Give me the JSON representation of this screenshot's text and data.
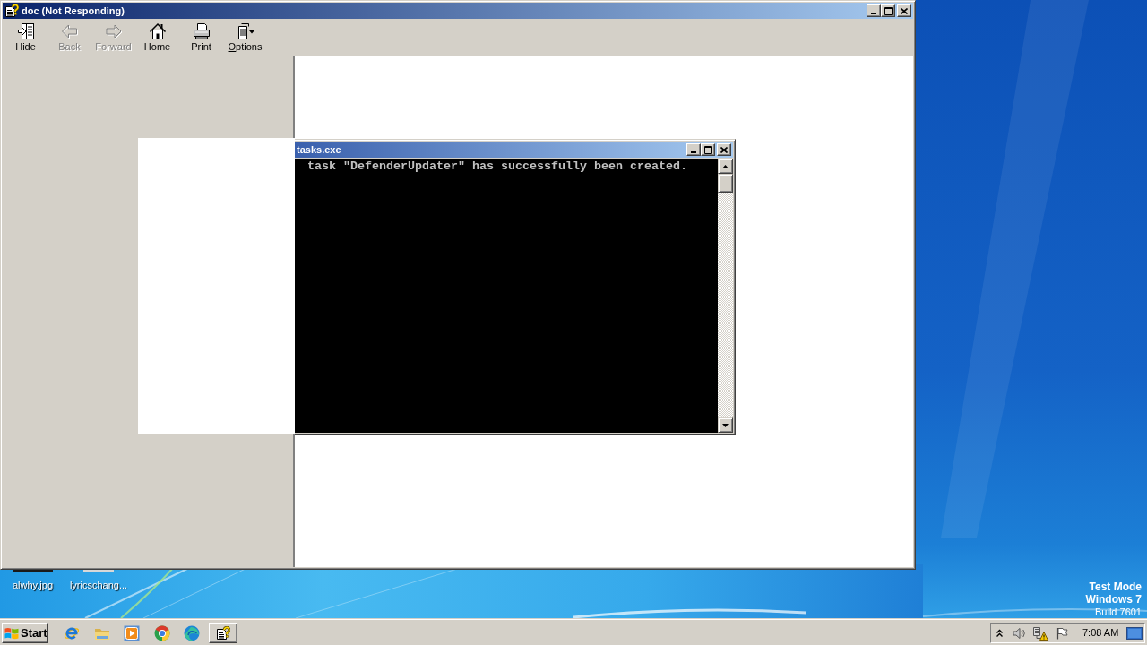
{
  "help_window": {
    "title": "doc (Not Responding)",
    "toolbar": [
      {
        "label": "Hide",
        "disabled": false,
        "underline_first": false
      },
      {
        "label": "Back",
        "disabled": true,
        "underline_first": false
      },
      {
        "label": "Forward",
        "disabled": true,
        "underline_first": false
      },
      {
        "label": "Home",
        "disabled": false,
        "underline_first": false
      },
      {
        "label": "Print",
        "disabled": false,
        "underline_first": false
      },
      {
        "label": "Options",
        "disabled": false,
        "underline_first": true
      }
    ]
  },
  "console_window": {
    "title": "tasks.exe",
    "lines": [
      "task \"DefenderUpdater\" has successfully been created."
    ]
  },
  "desktop": {
    "icons": [
      {
        "label": "alwhy.jpg"
      },
      {
        "label": "lyricschang..."
      }
    ],
    "system_text": [
      {
        "text": "Test Mode",
        "bold": true
      },
      {
        "text": "Windows 7",
        "bold": true
      },
      {
        "text": "Build 7601",
        "bold": false
      }
    ]
  },
  "taskbar": {
    "start_label": "Start",
    "clock": "7:08 AM"
  }
}
